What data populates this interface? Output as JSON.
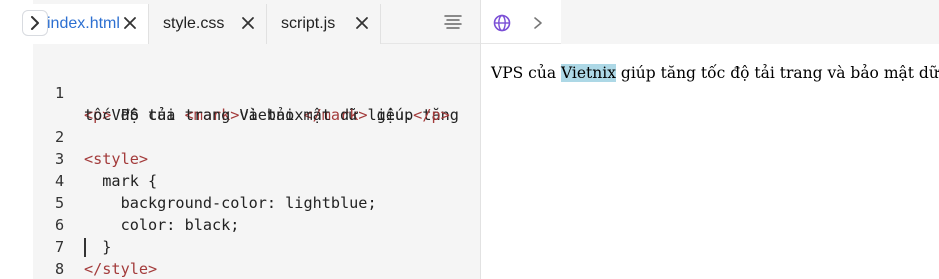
{
  "tabs": [
    {
      "label": "index.html",
      "active": true
    },
    {
      "label": "style.css",
      "active": false
    },
    {
      "label": "script.js",
      "active": false
    }
  ],
  "icons": {
    "collapse": "chevron-right-icon",
    "close": "close-icon",
    "menu": "menu-lines-icon",
    "globe": "globe-icon",
    "forward": "chevron-right-icon"
  },
  "colors": {
    "active_tab_text": "#2c6fd1",
    "tag": "#a33b3b",
    "highlight": "lightblue"
  },
  "code": {
    "line_numbers": [
      "1",
      "",
      "2",
      "3",
      "4",
      "5",
      "6",
      "7",
      "8"
    ],
    "line1a": {
      "open_p": "<p>",
      "text1": "VPS của ",
      "open_mark": "<mark>",
      "mark_text": "Vietnix",
      "close_mark": "</mark>",
      "text2": " giúp tăng"
    },
    "line1b": {
      "text": "tốc độ tải trang và bảo mật dữ liệu.",
      "close_p": "</p>"
    },
    "line2": "<style>",
    "line3": "  mark {",
    "line4": "    background-color: lightblue;",
    "line5": "    color: black;",
    "line6": "  }",
    "line7": "</style>",
    "line8": ""
  },
  "preview": {
    "before": "VPS của ",
    "mark": "Vietnix",
    "after": " giúp tăng tốc độ tải trang và bảo mật dữ liệu."
  }
}
